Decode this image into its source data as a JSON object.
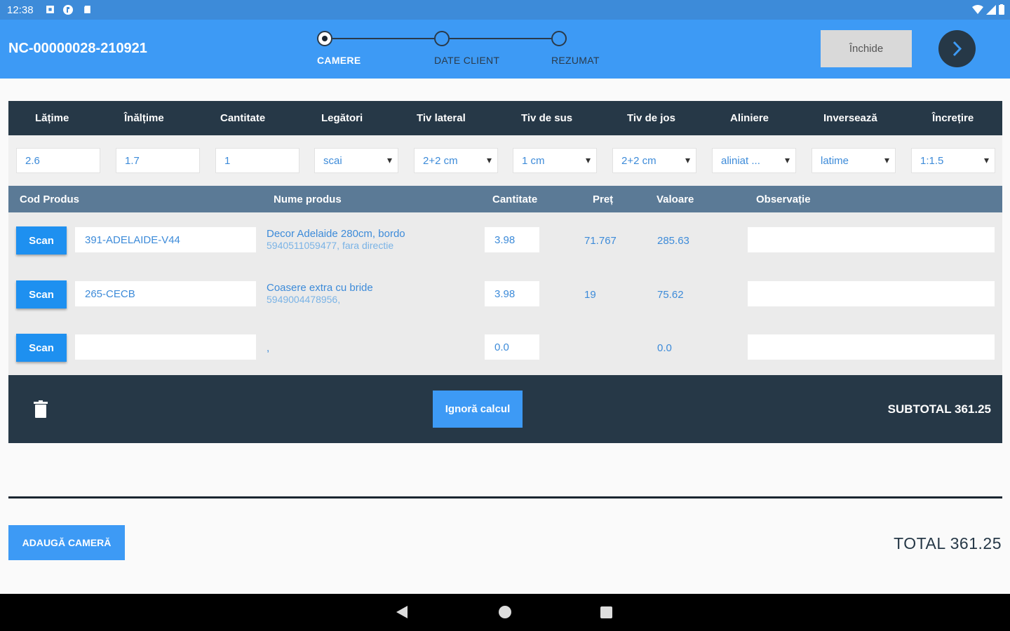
{
  "status_bar": {
    "time": "12:38"
  },
  "header": {
    "document_id": "NC-00000028-210921",
    "steps": [
      {
        "label": "CAMERE",
        "active": true
      },
      {
        "label": "DATE CLIENT",
        "active": false
      },
      {
        "label": "REZUMAT",
        "active": false
      }
    ],
    "close_label": "Închide",
    "next_icon": "chevron-right-icon"
  },
  "params": {
    "headers": [
      "Lățime",
      "Înălțime",
      "Cantitate",
      "Legători",
      "Tiv lateral",
      "Tiv de sus",
      "Tiv de jos",
      "Aliniere",
      "Inversează",
      "Încrețire"
    ],
    "values": [
      "2.6",
      "1.7",
      "1",
      "scai",
      "2+2 cm",
      "1 cm",
      "2+2 cm",
      "aliniat ...",
      "latime",
      "1:1.5"
    ]
  },
  "products": {
    "headers": {
      "code": "Cod Produs",
      "name": "Nume produs",
      "qty": "Cantitate",
      "price": "Preț",
      "value": "Valoare",
      "notes": "Observație"
    },
    "scan_label": "Scan",
    "rows": [
      {
        "code": "391-ADELAIDE-V44",
        "name": "Decor Adelaide 280cm, bordo",
        "sub": "5940511059477, fara directie",
        "qty": "3.98",
        "price": "71.767",
        "value": "285.63"
      },
      {
        "code": "265-CECB",
        "name": "Coasere extra cu bride",
        "sub": "5949004478956,",
        "qty": "3.98",
        "price": "19",
        "value": "75.62"
      },
      {
        "code": "",
        "name": ",",
        "sub": "",
        "qty": "0.0",
        "price": "",
        "value": "0.0"
      }
    ]
  },
  "footer": {
    "ignore_label": "Ignoră calcul",
    "subtotal": "SUBTOTAL 361.25"
  },
  "bottom": {
    "add_room_label": "ADAUGĂ CAMERĂ",
    "total": "TOTAL 361.25"
  }
}
